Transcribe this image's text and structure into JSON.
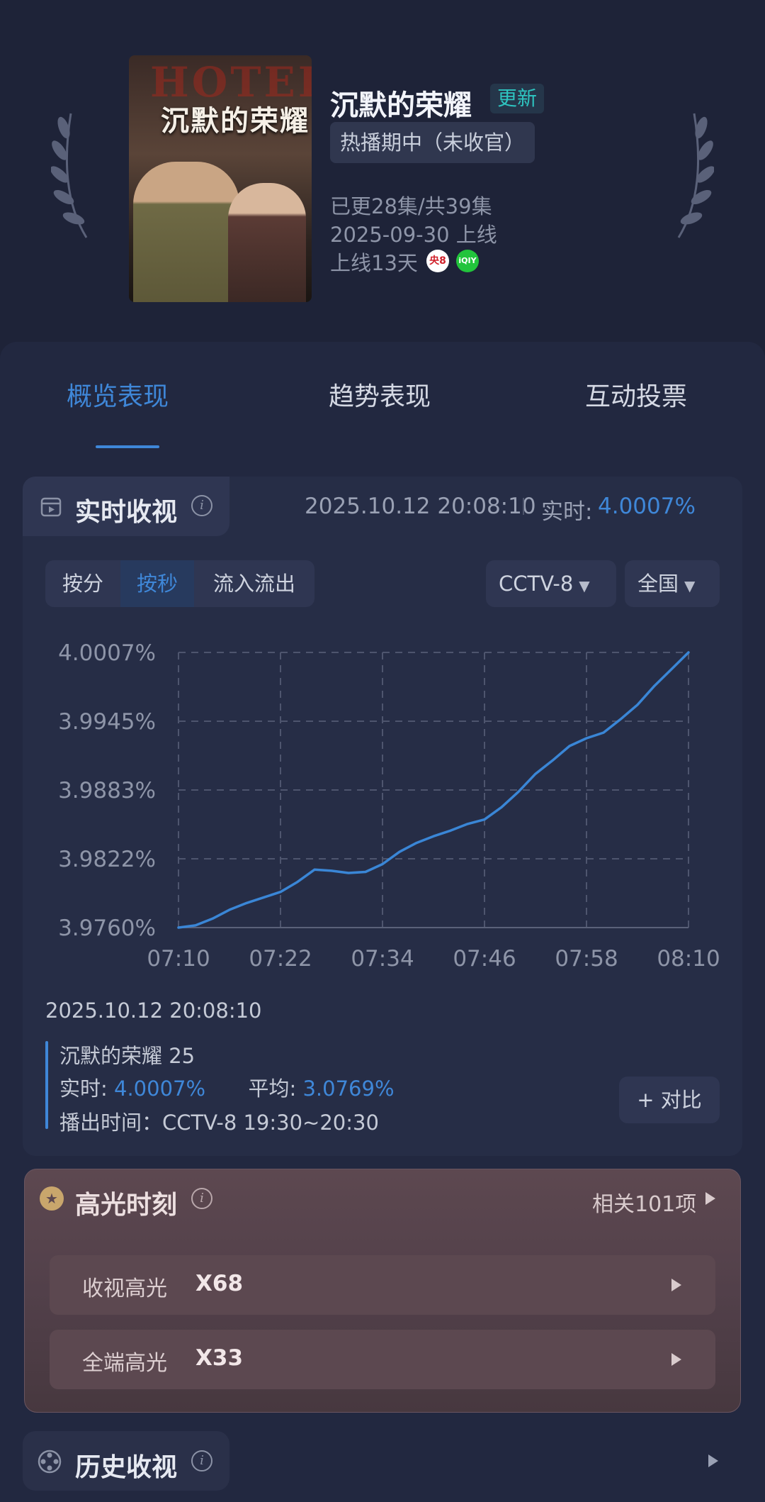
{
  "show": {
    "poster_title": "沉默的荣耀",
    "poster_bg_text": "HOTED",
    "title": "沉默的荣耀",
    "badge": "更新",
    "status": "热播期中（未收官）",
    "episodes": "已更28集/共39集",
    "premiere": "2025-09-30 上线",
    "days_online": "上线13天",
    "channel_icons": [
      "cctv8-icon",
      "iqiyi-icon"
    ],
    "cctv_icon_text": "央8",
    "iqiyi_icon_text": "iQIY"
  },
  "tabs": [
    "概览表现",
    "趋势表现",
    "互动投票"
  ],
  "realtime": {
    "title": "实时收视",
    "timestamp": "2025.10.12 20:08:10",
    "live_label": "实时:",
    "live_value": "4.0007%",
    "segments": [
      "按分",
      "按秒",
      "流入流出"
    ],
    "channel_select": "CCTV-8",
    "region_select": "全国"
  },
  "chart_data": {
    "type": "line",
    "y_tick_labels": [
      "4.0007%",
      "3.9945%",
      "3.9883%",
      "3.9822%",
      "3.9760%"
    ],
    "x_tick_labels": [
      "07:10",
      "07:22",
      "07:34",
      "07:46",
      "07:58",
      "08:10"
    ],
    "ylim": [
      3.976,
      4.0007
    ],
    "grid": true,
    "line_color": "#3a86d6",
    "series": [
      {
        "x": [
          "07:10",
          "07:12",
          "07:14",
          "07:16",
          "07:18",
          "07:20",
          "07:22",
          "07:24",
          "07:26",
          "07:28",
          "07:30",
          "07:32",
          "07:34",
          "07:36",
          "07:38",
          "07:40",
          "07:42",
          "07:44",
          "07:46",
          "07:48",
          "07:50",
          "07:52",
          "07:54",
          "07:56",
          "07:58",
          "08:00",
          "08:02",
          "08:04",
          "08:06",
          "08:08",
          "08:10"
        ],
        "values": [
          3.976,
          3.9762,
          3.9768,
          3.9776,
          3.9782,
          3.9787,
          3.9792,
          3.9801,
          3.9812,
          3.9811,
          3.9809,
          3.981,
          3.9817,
          3.9828,
          3.9836,
          3.9842,
          3.9847,
          3.9853,
          3.9857,
          3.9868,
          3.9882,
          3.9898,
          3.991,
          3.9923,
          3.993,
          3.9935,
          3.9947,
          3.996,
          3.9977,
          3.9992,
          4.0007
        ]
      }
    ]
  },
  "tooltip": {
    "time": "2025.10.12 20:08:10",
    "episode": "沉默的荣耀 25",
    "live_label": "实时:",
    "live_value": "4.0007%",
    "avg_label": "平均:",
    "avg_value": "3.0769%",
    "broadcast": "播出时间：CCTV-8 19:30~20:30",
    "compare_button": "+ 对比"
  },
  "highlights": {
    "title": "高光时刻",
    "related": "相关101项",
    "rows": [
      {
        "label": "收视高光",
        "value": "X68"
      },
      {
        "label": "全端高光",
        "value": "X33"
      }
    ]
  },
  "history": {
    "title": "历史收视"
  }
}
